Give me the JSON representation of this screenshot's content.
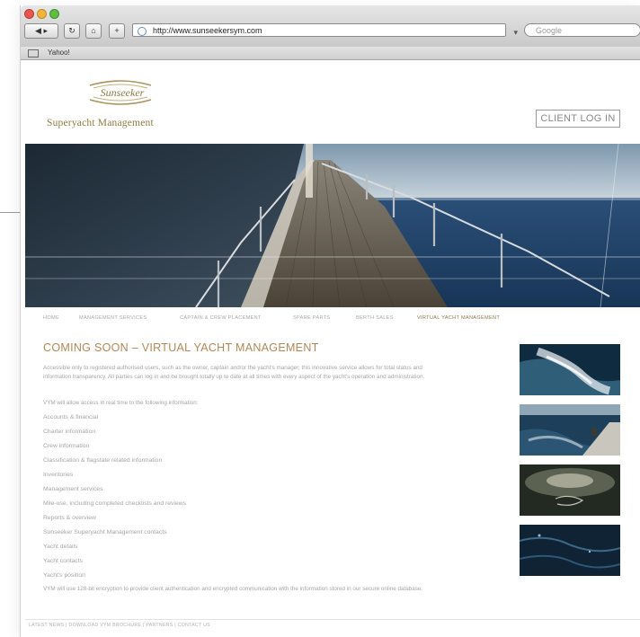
{
  "browser": {
    "url": "http://www.sunseekersym.com",
    "search_placeholder": "Google",
    "bookmark_label": "Yahoo!",
    "back_label": "◀ ▸",
    "reload_label": "↻",
    "home_label": "⌂",
    "add_label": "+"
  },
  "site": {
    "logo_text": "Sunseeker",
    "tagline": "Superyacht Management",
    "client_login": "CLIENT LOG IN",
    "brand_color": "#8f7a42"
  },
  "nav": {
    "items": [
      {
        "label": "HOME"
      },
      {
        "label": "MANAGEMENT SERVICES"
      },
      {
        "label": "CAPTAIN & CREW PLACEMENT"
      },
      {
        "label": "SPARE PARTS"
      },
      {
        "label": "BERTH SALES"
      },
      {
        "label": "VIRTUAL YACHT MANAGEMENT"
      }
    ]
  },
  "content": {
    "heading": "COMING SOON – VIRTUAL YACHT MANAGEMENT",
    "intro": "Accessible only to registered authorised users, such as the owner, captain and/or the yacht's manager, this innovative service allows for total status and information transparency. All parties can log in and be brought totally up to date at all times with every aspect of the yacht's operation and administration.",
    "list_intro": "VYM will allow access in real time to the following information:",
    "list": [
      "Accounts & financial",
      "Charter information",
      "Crew information",
      "Classification & flagstate related information",
      "Inventories",
      "Management services",
      "Mile-use, including completed checklists and reviews",
      "Reports & overview",
      "Sunseeker Superyacht Management contacts",
      "Yacht details",
      "Yacht contacts",
      "Yacht's position"
    ],
    "closing": "VYM will use 128-bit encryption to provide client authentication and encrypted communication with the information stored in our secure online database."
  },
  "footer": {
    "text": "LATEST NEWS | DOWNLOAD VYM BROCHURE | PARTNERS | CONTACT US"
  }
}
